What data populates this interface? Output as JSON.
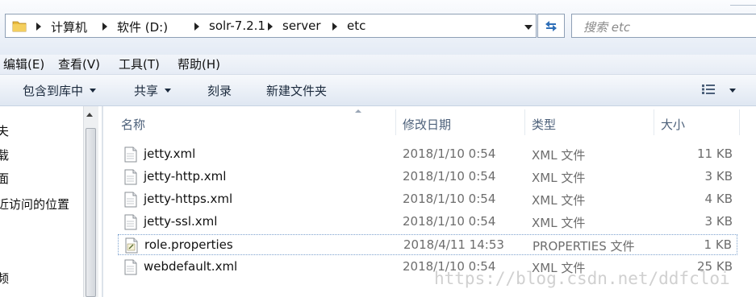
{
  "address_bar": {
    "crumbs": [
      "计算机",
      "软件 (D:)",
      "solr-7.2.1",
      "server",
      "etc"
    ]
  },
  "search": {
    "placeholder": "搜索 etc"
  },
  "menu": [
    "编辑(E)",
    "查看(V)",
    "工具(T)",
    "帮助(H)"
  ],
  "commands": {
    "include_library": "包含到库中",
    "share": "共享",
    "burn": "刻录",
    "new_folder": "新建文件夹"
  },
  "nav_pane": [
    "夫",
    "载",
    "面",
    "近访问的位置",
    "频"
  ],
  "columns": {
    "name": "名称",
    "date": "修改日期",
    "type": "类型",
    "size": "大小"
  },
  "files": [
    {
      "name": "jetty.xml",
      "date": "2018/1/10 0:54",
      "type": "XML 文件",
      "size": "11 KB",
      "icon": "xml-file-icon"
    },
    {
      "name": "jetty-http.xml",
      "date": "2018/1/10 0:54",
      "type": "XML 文件",
      "size": "3 KB",
      "icon": "xml-file-icon"
    },
    {
      "name": "jetty-https.xml",
      "date": "2018/1/10 0:54",
      "type": "XML 文件",
      "size": "4 KB",
      "icon": "xml-file-icon"
    },
    {
      "name": "jetty-ssl.xml",
      "date": "2018/1/10 0:54",
      "type": "XML 文件",
      "size": "3 KB",
      "icon": "xml-file-icon"
    },
    {
      "name": "role.properties",
      "date": "2018/4/11 14:53",
      "type": "PROPERTIES 文件",
      "size": "1 KB",
      "icon": "properties-file-icon"
    },
    {
      "name": "webdefault.xml",
      "date": "2018/1/10 0:54",
      "type": "XML 文件",
      "size": "25 KB",
      "icon": "xml-file-icon"
    }
  ],
  "watermark": "https://blog.csdn.net/ddfcloi",
  "colors": {
    "focus_border": "#7da2ce",
    "header_text": "#4c607a",
    "folder": "#e8b93c"
  }
}
